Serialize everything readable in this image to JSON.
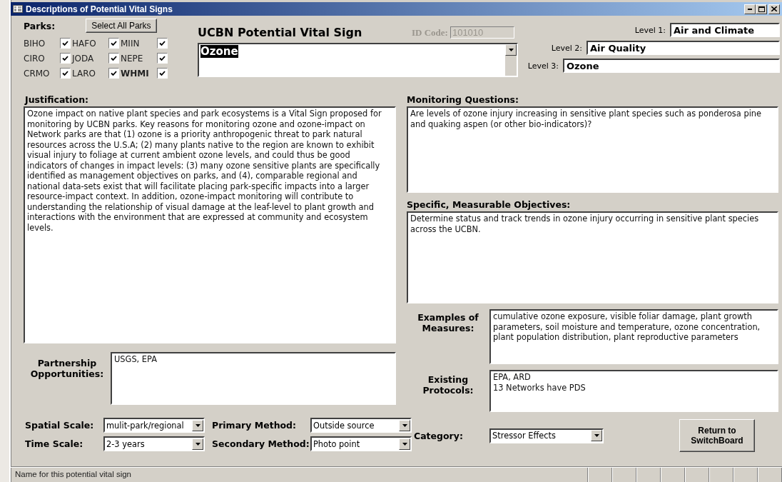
{
  "window": {
    "title": "Descriptions of Potential Vital Signs"
  },
  "parks": {
    "label": "Parks:",
    "select_all_button": "Select All Parks",
    "items": [
      {
        "code": "BIHO",
        "checked": true,
        "bold": false
      },
      {
        "code": "CIRO",
        "checked": true,
        "bold": false
      },
      {
        "code": "CRMO",
        "checked": true,
        "bold": false
      },
      {
        "code": "HAFO",
        "checked": true,
        "bold": false
      },
      {
        "code": "JODA",
        "checked": true,
        "bold": false
      },
      {
        "code": "LARO",
        "checked": true,
        "bold": false
      },
      {
        "code": "MIIN",
        "checked": true,
        "bold": false
      },
      {
        "code": "NEPE",
        "checked": true,
        "bold": false
      },
      {
        "code": "WHMI",
        "checked": true,
        "bold": true
      }
    ]
  },
  "vital_sign": {
    "heading": "UCBN Potential Vital Sign",
    "value": "Ozone",
    "id_code_label": "ID Code:",
    "id_code": "101010",
    "id_disabled": true
  },
  "levels": [
    {
      "label": "Level 1:",
      "value": "Air and Climate"
    },
    {
      "label": "Level 2:",
      "value": "Air Quality"
    },
    {
      "label": "Level 3:",
      "value": "Ozone"
    }
  ],
  "justification": {
    "label": "Justification:",
    "text": "Ozone impact on native plant species and park ecosystems is a Vital Sign proposed for monitoring by UCBN parks. Key reasons for monitoring ozone and ozone-impact on Network parks are that (1) ozone is a priority anthropogenic threat to park natural resources across the U.S.A; (2) many plants native to the region are known to exhibit visual injury to foliage at current ambient ozone levels, and could thus be good indicators of changes in impact levels: (3) many ozone sensitive plants are specifically identified as management objectives on parks, and (4), comparable regional and national data-sets exist that will facilitate placing park-specific impacts into a larger resource-impact context. In addition, ozone-impact monitoring will contribute to understanding the relationship of visual damage at the leaf-level to plant growth and interactions with the environment that are expressed at community and ecosystem levels."
  },
  "partnership": {
    "label": "Partnership Opportunities:",
    "text": "USGS, EPA"
  },
  "monitoring_questions": {
    "label": "Monitoring Questions:",
    "text": "Are levels of ozone injury increasing in sensitive plant species such as ponderosa pine and quaking aspen (or other bio-indicators)?"
  },
  "objectives": {
    "label": "Specific, Measurable Objectives:",
    "text": "Determine status and track trends in ozone injury occurring in sensitive plant species across the UCBN."
  },
  "measures": {
    "label": "Examples of Measures:",
    "text": "cumulative ozone exposure, visible foliar damage, plant growth parameters, soil moisture and temperature, ozone concentration, plant population distribution, plant reproductive parameters"
  },
  "protocols": {
    "label": "Existing Protocols:",
    "text": "EPA, ARD\n13 Networks have PDS"
  },
  "selectors": [
    {
      "label": "Spatial Scale:",
      "value": "mulit-park/regional"
    },
    {
      "label": "Primary Method:",
      "value": "Outside source"
    },
    {
      "label": "Time Scale:",
      "value": "2-3 years"
    },
    {
      "label": "Secondary Method:",
      "value": "Photo point"
    }
  ],
  "category": {
    "label": "Category:",
    "value": "Stressor Effects"
  },
  "return_button": "Return to SwitchBoard",
  "status_bar": {
    "text": "Name for this potential vital sign"
  }
}
